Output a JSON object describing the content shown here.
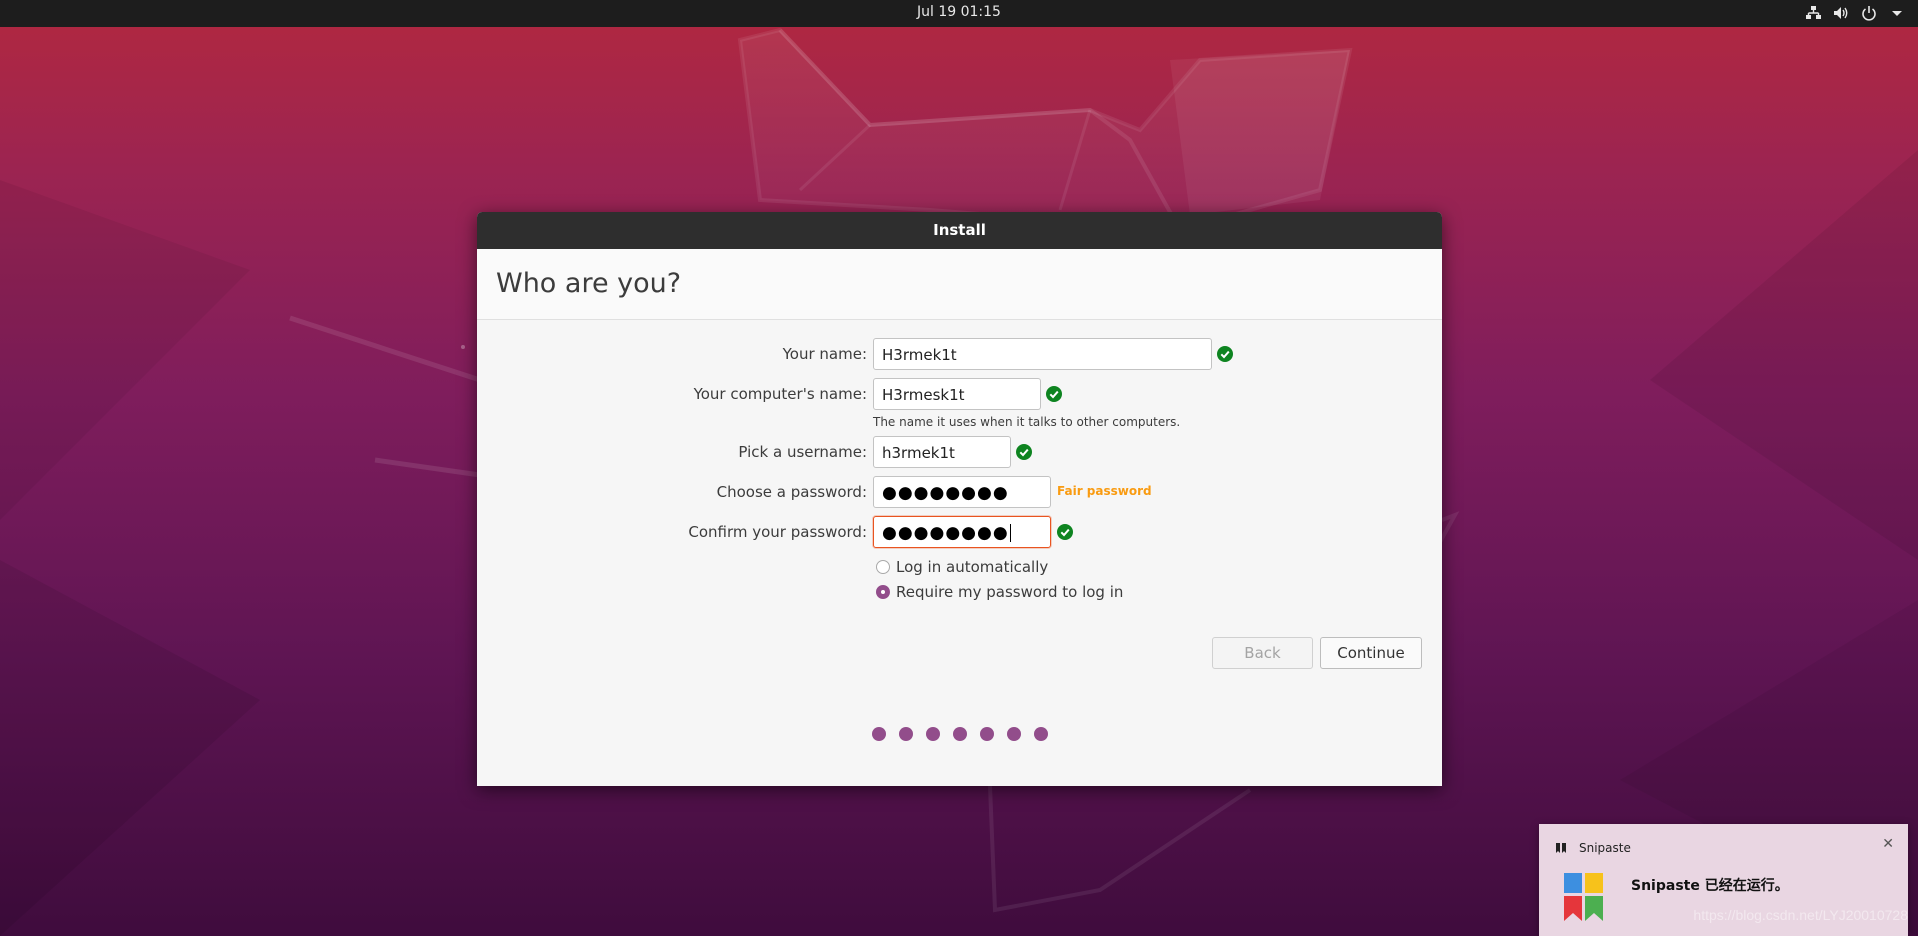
{
  "topbar": {
    "clock": "Jul 19  01:15",
    "icons": [
      "network-icon",
      "volume-icon",
      "power-icon",
      "dropdown-arrow-icon"
    ]
  },
  "dialog": {
    "title": "Install",
    "heading": "Who are you?",
    "fields": {
      "name": {
        "label": "Your name:",
        "value": "H3rmek1t",
        "valid": true
      },
      "computer": {
        "label": "Your computer's name:",
        "value": "H3rmesk1t",
        "hint": "The name it uses when it talks to other computers.",
        "valid": true
      },
      "username": {
        "label": "Pick a username:",
        "value": "h3rmek1t",
        "valid": true
      },
      "password": {
        "label": "Choose a password:",
        "value": "●●●●●●●●",
        "strength": "Fair password"
      },
      "confirm": {
        "label": "Confirm your password:",
        "value": "●●●●●●●●",
        "valid": true
      }
    },
    "login_options": [
      {
        "label": "Log in automatically",
        "selected": false
      },
      {
        "label": "Require my password to log in",
        "selected": true
      }
    ],
    "buttons": {
      "back": "Back",
      "continue": "Continue"
    },
    "progress_steps": 7,
    "accent_color": "#924d8b",
    "check_color": "#0e8420",
    "strength_color": "#f99b11"
  },
  "notification": {
    "app": "Snipaste",
    "message": "Snipaste 已经在运行。",
    "icon": "snipaste-logo-icon"
  },
  "watermark": "https://blog.csdn.net/LYJ20010728"
}
